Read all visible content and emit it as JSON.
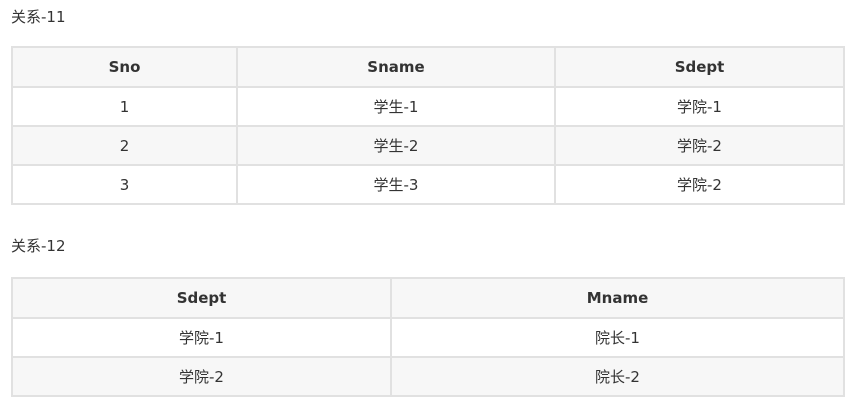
{
  "tables": [
    {
      "caption": "关系-11",
      "headers": [
        "Sno",
        "Sname",
        "Sdept"
      ],
      "rows": [
        [
          "1",
          "学生-1",
          "学院-1"
        ],
        [
          "2",
          "学生-2",
          "学院-2"
        ],
        [
          "3",
          "学生-3",
          "学院-2"
        ]
      ]
    },
    {
      "caption": "关系-12",
      "headers": [
        "Sdept",
        "Mname"
      ],
      "rows": [
        [
          "学院-1",
          "院长-1"
        ],
        [
          "学院-2",
          "院长-2"
        ]
      ]
    }
  ]
}
